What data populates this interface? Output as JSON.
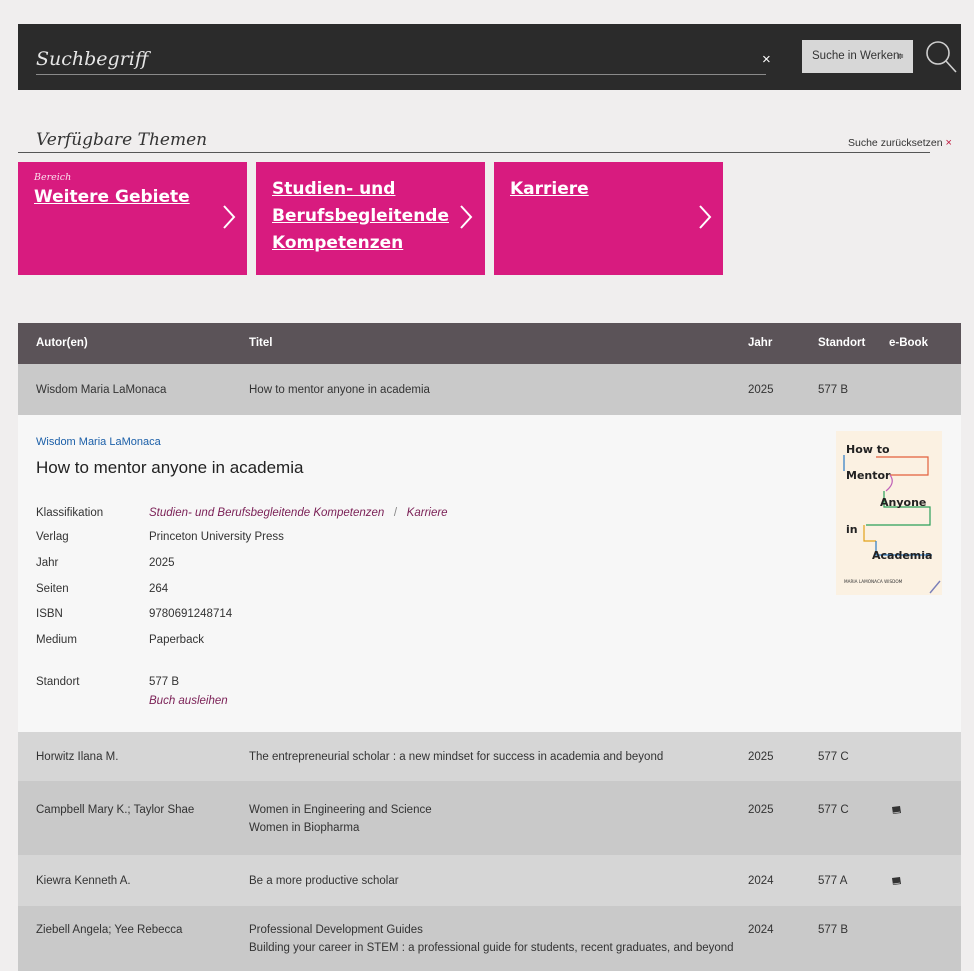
{
  "search": {
    "placeholder": "Suchbegriff",
    "clear_label": "×",
    "scope_selected": "Suche in Werken",
    "scope_arrows": "≑"
  },
  "themes": {
    "title": "Verfügbare Themen",
    "reset_label": "Suche zurücksetzen",
    "reset_x": "×",
    "tiles": [
      {
        "caption": "Bereich",
        "lines": [
          "Weitere Gebiete"
        ]
      },
      {
        "caption": "",
        "lines": [
          "Studien- und",
          "Berufsbegleitende",
          "Kompetenzen"
        ]
      },
      {
        "caption": "",
        "lines": [
          "Karriere"
        ]
      }
    ]
  },
  "table": {
    "columns": [
      "Autor(en)",
      "Titel",
      "Jahr",
      "Standort",
      "e-Book"
    ],
    "rows": [
      {
        "author": "Wisdom Maria LaMonaca",
        "titles": [
          "How to mentor anyone in academia"
        ],
        "year": "2025",
        "location": "577 B",
        "ebook": false
      },
      {
        "author": "Horwitz Ilana M.",
        "titles": [
          "The entrepreneurial scholar : a new mindset for success in academia and beyond"
        ],
        "year": "2025",
        "location": "577 C",
        "ebook": false
      },
      {
        "author": "Campbell Mary K.; Taylor Shae",
        "titles": [
          "Women in Engineering and Science",
          "Women in Biopharma"
        ],
        "year": "2025",
        "location": "577 C",
        "ebook": true
      },
      {
        "author": "Kiewra Kenneth A.",
        "titles": [
          "Be a more productive scholar"
        ],
        "year": "2024",
        "location": "577 A",
        "ebook": true
      },
      {
        "author": "Ziebell Angela; Yee Rebecca",
        "titles": [
          "Professional Development Guides",
          "Building your career in STEM : a professional guide for students, recent graduates, and beyond"
        ],
        "year": "2024",
        "location": "577 B",
        "ebook": false
      }
    ]
  },
  "detail": {
    "author": "Wisdom Maria LaMonaca",
    "title": "How to mentor anyone in academia",
    "classification_label": "Klassifikation",
    "classification": [
      "Studien- und Berufsbegleitende Kompetenzen",
      "Karriere"
    ],
    "classification_sep": "/",
    "fields": [
      {
        "label": "Verlag",
        "value": "Princeton University Press"
      },
      {
        "label": "Jahr",
        "value": "2025"
      },
      {
        "label": "Seiten",
        "value": "264"
      },
      {
        "label": "ISBN",
        "value": "9780691248714"
      },
      {
        "label": "Medium",
        "value": "Paperback"
      }
    ],
    "location_label": "Standort",
    "location": "577 B",
    "borrow_label": "Buch ausleihen",
    "cover": {
      "words": [
        "How to",
        "Mentor",
        "Anyone",
        "in",
        "Academia"
      ],
      "author_line": "MARIA LAMONACA WISDOM"
    }
  },
  "colors": {
    "accent": "#d81b7f",
    "header": "#2b2b2b",
    "table_head": "#5b5358",
    "link": "#1b5fa8",
    "italic_link": "#7a1f55"
  }
}
